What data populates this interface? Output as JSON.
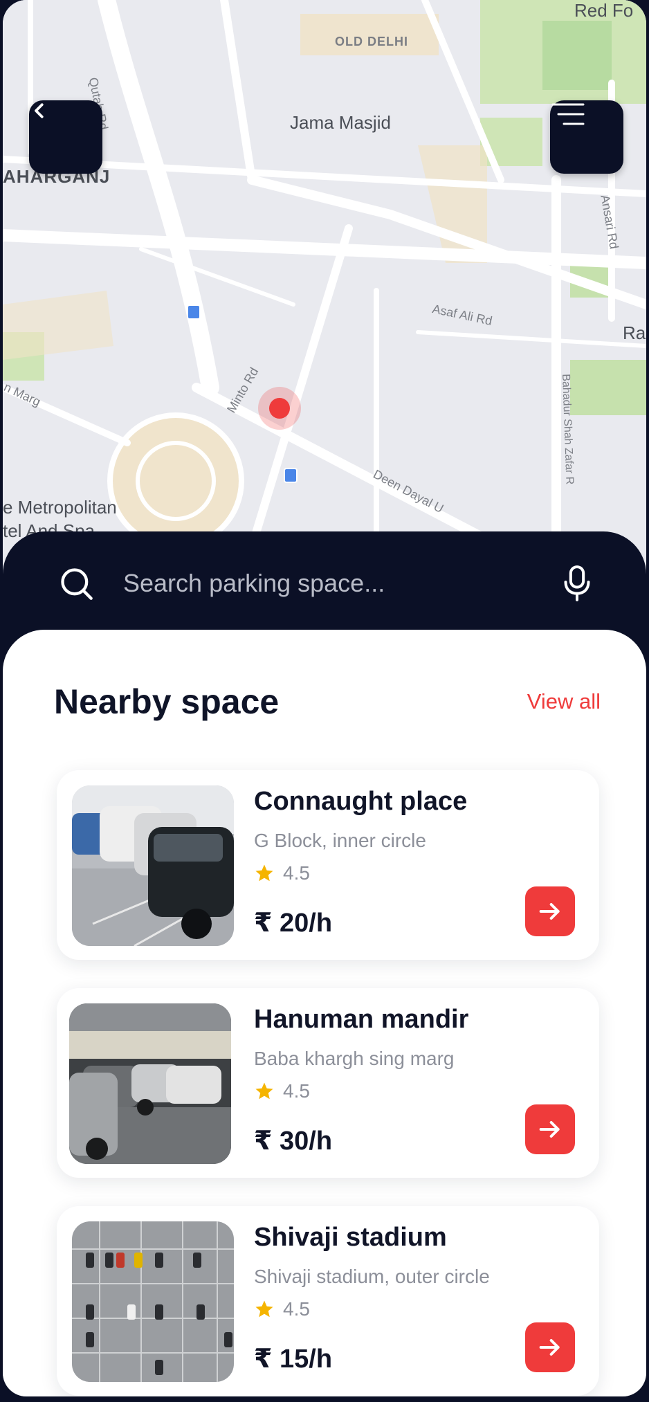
{
  "map": {
    "labels": {
      "old_delhi": "OLD DELHI",
      "jama_masjid": "Jama Masjid",
      "paharganj": "AHARGANJ",
      "qutab_rd": "Qutab Rd",
      "ansari_rd": "Ansari Rd",
      "asaf_ali_rd": "Asaf Ali Rd",
      "minto_rd": "Minto Rd",
      "bahadur_shah": "Bahadur Shah Zafar R",
      "deen_dayal": "Deen Dayal U",
      "metropolitan": "e Metropolitan",
      "tel_and": "tel And Spa",
      "ra": "Ra",
      "marg": "n Marg",
      "red_fort": "Red Fo"
    },
    "back_icon": "chevron-left-icon",
    "menu_icon": "menu-icon"
  },
  "search": {
    "placeholder": "Search parking space...",
    "icon": "search-icon",
    "mic_icon": "mic-icon"
  },
  "nearby": {
    "title": "Nearby space",
    "view_all": "View all",
    "items": [
      {
        "name": "Connaught place",
        "address": "G Block, inner circle",
        "rating": "4.5",
        "price": "₹ 20/h"
      },
      {
        "name": "Hanuman mandir",
        "address": "Baba khargh sing marg",
        "rating": "4.5",
        "price": "₹ 30/h"
      },
      {
        "name": "Shivaji stadium",
        "address": "Shivaji stadium, outer circle",
        "rating": "4.5",
        "price": "₹ 15/h"
      }
    ]
  },
  "colors": {
    "dark": "#0b1026",
    "accent": "#ef3b3b",
    "star": "#f5b400"
  }
}
